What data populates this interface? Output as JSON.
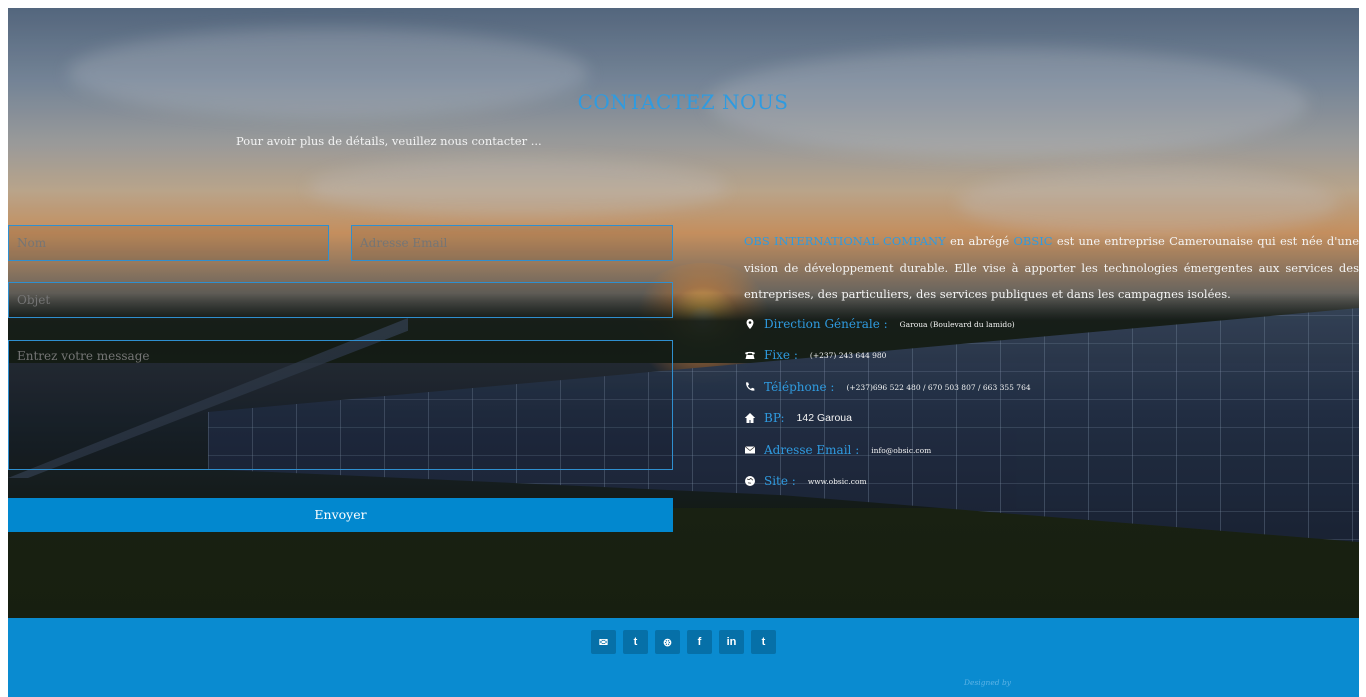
{
  "page_title": "CONTACTEZ NOUS",
  "subtitle": "Pour avoir plus de détails, veuillez nous contacter ...",
  "form": {
    "name_placeholder": "Nom",
    "email_placeholder": "Adresse Email",
    "subject_placeholder": "Objet",
    "message_placeholder": "Entrez votre message",
    "send_label": "Envoyer"
  },
  "about": {
    "company_name": "OBS INTERNATIONAL COMPANY",
    "abbr_intro": "en abrégé",
    "abbr": "OBSIC",
    "description": "est une entreprise Camerounaise qui est née d'une vision de développement durable. Elle vise à apporter les technologies émergentes aux services des entreprises, des particuliers, des services publiques et dans les campagnes isolées."
  },
  "info": [
    {
      "icon": "map-marker-icon",
      "label": "Direction Générale :",
      "value": "Garoua (Boulevard du lamido)"
    },
    {
      "icon": "fax-icon",
      "label": "Fixe :",
      "value": "(+237) 243 644 980"
    },
    {
      "icon": "phone-icon",
      "label": "Téléphone :",
      "value": "(+237)696 522 480 / 670 503 807 / 663 355 764"
    },
    {
      "icon": "home-icon",
      "label": "BP:",
      "value": "142 Garoua"
    },
    {
      "icon": "envelope-icon",
      "label": "Adresse Email :",
      "value": "info@obsic.com"
    },
    {
      "icon": "globe-icon",
      "label": "Site :",
      "value": "www.obsic.com"
    }
  ],
  "footer": {
    "social": [
      {
        "icon": "envelope-icon",
        "glyph": "✉"
      },
      {
        "icon": "twitter-icon",
        "glyph": "t"
      },
      {
        "icon": "dribbble-icon",
        "glyph": "⊛"
      },
      {
        "icon": "facebook-icon",
        "glyph": "f"
      },
      {
        "icon": "linkedin-icon",
        "glyph": "in"
      },
      {
        "icon": "tumblr-icon",
        "glyph": "t"
      }
    ],
    "designed_by": "Designed by"
  },
  "colors": {
    "accent": "#2f9be0",
    "button": "#0288cf",
    "footer": "#0a8bd0"
  }
}
